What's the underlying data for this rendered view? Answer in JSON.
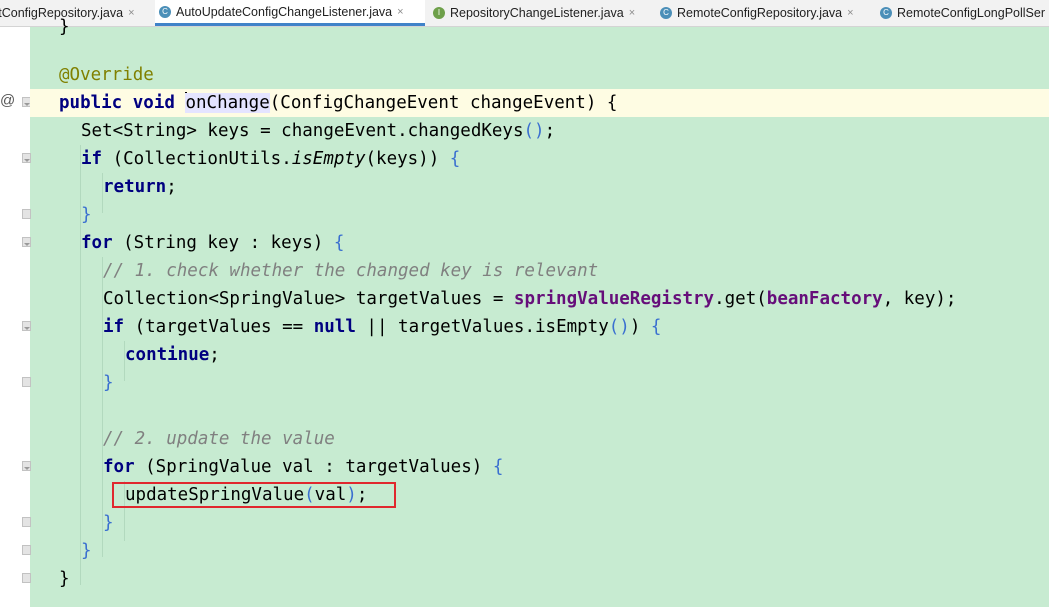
{
  "tabs": [
    {
      "label": "ctConfigRepository.java",
      "icon": "class-icon",
      "active": false
    },
    {
      "label": "AutoUpdateConfigChangeListener.java",
      "icon": "class-icon",
      "active": true
    },
    {
      "label": "RepositoryChangeListener.java",
      "icon": "interface-icon",
      "active": false
    },
    {
      "label": "RemoteConfigRepository.java",
      "icon": "class-icon",
      "active": false
    },
    {
      "label": "RemoteConfigLongPollSer",
      "icon": "class-icon",
      "active": false
    }
  ],
  "icon_letters": {
    "class": "C",
    "interface": "I"
  },
  "close_glyph": "×",
  "gutter": {
    "override_marker": "@"
  },
  "code": {
    "l0": "}",
    "l2": "@Override",
    "l3": {
      "k1": "public",
      "k2": "void",
      "name": "onChange",
      "rest": "(ConfigChangeEvent changeEvent) {"
    },
    "l4": {
      "text": "Set<String> keys = changeEvent.changedKeys",
      "paren": "()",
      "semi": ";"
    },
    "l5": {
      "kw": "if",
      "p1": " (CollectionUtils.",
      "method": "isEmpty",
      "p2": "(keys)) ",
      "brace": "{"
    },
    "l6": {
      "kw": "return",
      "semi": ";"
    },
    "l7": "}",
    "l8": {
      "kw": "for",
      "rest": " (String key : keys) ",
      "brace": "{"
    },
    "l9": "// 1. check whether the changed key is relevant",
    "l10": {
      "t1": "Collection<SpringValue> targetValues = ",
      "f1": "springValueRegistry",
      "t2": ".get(",
      "f2": "beanFactory",
      "t3": ", key);"
    },
    "l11": {
      "kw": "if",
      "t1": " (targetValues == ",
      "kw2": "null",
      "t2": " || targetValues.isEmpty",
      "paren": "()",
      "t3": ") ",
      "brace": "{"
    },
    "l12": {
      "kw": "continue",
      "semi": ";"
    },
    "l13": "}",
    "l15": "// 2. update the value",
    "l16": {
      "kw": "for",
      "rest": " (SpringValue val : targetValues) ",
      "brace": "{"
    },
    "l17": {
      "name": "updateSpringValue",
      "p1": "(",
      "arg": "val",
      "p2": ")",
      "semi": ";"
    },
    "l18": "}",
    "l19": "}",
    "l20": "}"
  }
}
